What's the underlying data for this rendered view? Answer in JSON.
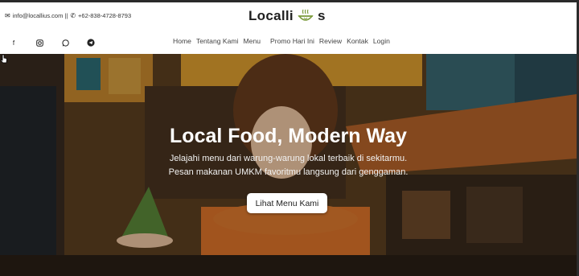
{
  "header": {
    "email": "info@locallius.com ||",
    "phone": "+62-838-4728-8793",
    "brand_left": "Localli",
    "brand_right": "s",
    "brand_logo_icon": "bowl-icon"
  },
  "social": [
    "facebook-icon",
    "instagram-icon",
    "whatsapp-icon",
    "telegram-icon"
  ],
  "nav": [
    "Home",
    "Tentang Kami",
    "Menu",
    "Promo Hari Ini",
    "Review",
    "Kontak",
    "Login"
  ],
  "hero": {
    "title": "Local Food, Modern Way",
    "subtitle_line1": "Jelajahi menu dari warung-warung lokal terbaik di sekitarmu.",
    "subtitle_line2": "Pesan makanan UMKM favoritmu langsung dari genggaman.",
    "cta_label": "Lihat Menu Kami"
  },
  "colors": {
    "brand_green": "#7a9a3a",
    "hero_orange": "#d98a3a"
  }
}
